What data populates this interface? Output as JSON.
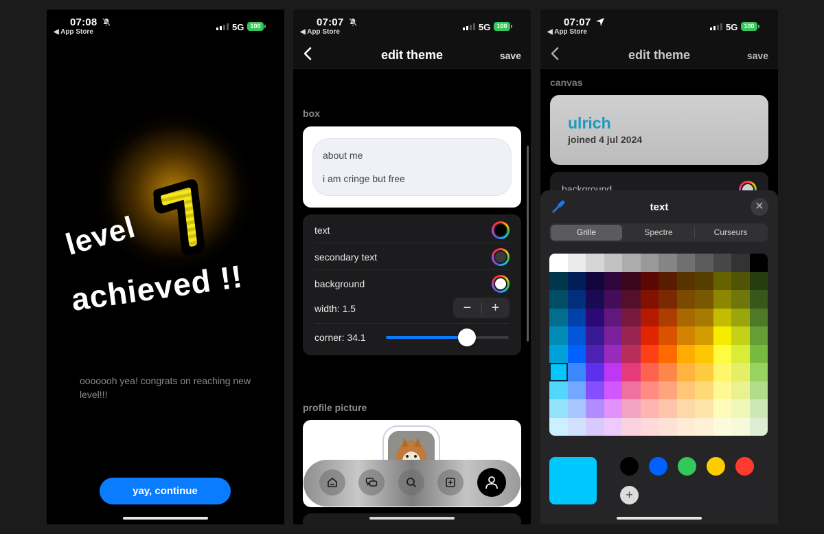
{
  "status_bars": [
    {
      "time": "07:08",
      "indicator_icon": "bell-slash-icon",
      "back_app": "◀ App Store",
      "network": "5G",
      "battery": "100"
    },
    {
      "time": "07:07",
      "indicator_icon": "bell-slash-icon",
      "back_app": "◀ App Store",
      "network": "5G",
      "battery": "100"
    },
    {
      "time": "07:07",
      "indicator_icon": "location-arrow-icon",
      "back_app": "◀ App Store",
      "network": "5G",
      "battery": "100"
    }
  ],
  "level_screen": {
    "level_word": "level",
    "level_number": "1",
    "achieved_word": "achieved !!",
    "message": "ooooooh yea! congrats on reaching new level!!!",
    "continue_label": "yay, continue",
    "colors": {
      "accent": "#0a7cff",
      "glow": "#d7960a",
      "badge_yellow": "#f4e40a"
    }
  },
  "edit_theme": {
    "nav": {
      "back_icon": "chevron-left-icon",
      "title": "edit theme",
      "save_label": "save"
    },
    "box_section": {
      "label": "box",
      "preview": {
        "heading": "about me",
        "body": "i am cringe but free"
      },
      "color_rows": [
        {
          "label": "text",
          "color": "#000000"
        },
        {
          "label": "secondary text",
          "color": "#3a3a3c"
        },
        {
          "label": "background",
          "color": "#ffffff"
        }
      ],
      "width": {
        "label": "width: 1.5",
        "value": 1.5,
        "minus": "−",
        "plus": "+"
      },
      "corner": {
        "label": "corner: 34.1",
        "value": 34.1,
        "slider_fraction": 0.66
      }
    },
    "profile_picture_section": {
      "label": "profile picture"
    },
    "tab_bar": [
      {
        "name": "home",
        "icon": "home-icon",
        "active": false
      },
      {
        "name": "messages",
        "icon": "chat-bubbles-icon",
        "active": false
      },
      {
        "name": "search",
        "icon": "search-icon",
        "active": false
      },
      {
        "name": "create",
        "icon": "plus-square-icon",
        "active": false
      },
      {
        "name": "profile",
        "icon": "person-icon",
        "active": true
      }
    ]
  },
  "edit_theme_picker": {
    "nav": {
      "back_icon": "chevron-left-icon",
      "title": "edit theme",
      "save_label": "save"
    },
    "canvas_section": {
      "label": "canvas",
      "username": "ulrich",
      "joined": "joined 4 jul 2024",
      "username_color": "#1a9ac0",
      "background_row_label": "background"
    },
    "color_picker": {
      "title": "text",
      "eyedropper_icon": "eyedropper-icon",
      "close_label": "✕",
      "tabs": [
        {
          "label": "Grille",
          "selected": true
        },
        {
          "label": "Spectre",
          "selected": false
        },
        {
          "label": "Curseurs",
          "selected": false
        }
      ],
      "selected_color": "#00c8ff",
      "selected_cell": {
        "row": 6,
        "col": 0
      },
      "grid": [
        [
          "#ffffff",
          "#ebebeb",
          "#d6d6d6",
          "#c2c2c2",
          "#adadad",
          "#999999",
          "#858585",
          "#707070",
          "#5c5c5c",
          "#474747",
          "#333333",
          "#000000"
        ],
        [
          "#00374a",
          "#011d57",
          "#11053b",
          "#2e063d",
          "#3c071b",
          "#5c0701",
          "#5a1c00",
          "#583300",
          "#563d00",
          "#666100",
          "#4f5504",
          "#263e0f"
        ],
        [
          "#004d65",
          "#012f7b",
          "#1a0a52",
          "#450d59",
          "#551029",
          "#831100",
          "#7b2900",
          "#7a4a00",
          "#785800",
          "#8c8602",
          "#6f760a",
          "#38571a"
        ],
        [
          "#016e8f",
          "#0042a9",
          "#2c0977",
          "#61187c",
          "#791a3d",
          "#b51a00",
          "#ad3e00",
          "#a96800",
          "#a67b01",
          "#c4bc00",
          "#9ba50e",
          "#4e7a27"
        ],
        [
          "#008cb4",
          "#0056d6",
          "#371a94",
          "#7a219e",
          "#99244f",
          "#e22400",
          "#da5100",
          "#d38301",
          "#d19d01",
          "#f5ec00",
          "#c3d117",
          "#669d34"
        ],
        [
          "#00a1d8",
          "#0061fe",
          "#4d22b2",
          "#982abc",
          "#b92d5d",
          "#ff4015",
          "#ff6a00",
          "#ffab01",
          "#fcc700",
          "#fefb41",
          "#d9ec37",
          "#76bb40"
        ],
        [
          "#01c7fc",
          "#3a87fe",
          "#5e30eb",
          "#be38f3",
          "#e63b7a",
          "#fe6250",
          "#fe8648",
          "#feb43f",
          "#fecb3e",
          "#fff76b",
          "#e4ef65",
          "#96d35f"
        ],
        [
          "#52d6fc",
          "#74a7ff",
          "#864ffe",
          "#d357fe",
          "#ee719e",
          "#ff8c82",
          "#fea57d",
          "#ffc777",
          "#fed977",
          "#fff994",
          "#eaf28f",
          "#b1dd8b"
        ],
        [
          "#93e3fc",
          "#a7c6ff",
          "#b18cfe",
          "#e292fe",
          "#f4a4c0",
          "#ffb5af",
          "#ffc5ab",
          "#fed9a8",
          "#fde4a8",
          "#fffbb9",
          "#f1f7b7",
          "#cde8b5"
        ],
        [
          "#cbf0ff",
          "#d2e2fe",
          "#d8c9fe",
          "#efcaff",
          "#f9d3e0",
          "#ffdad8",
          "#ffe2d6",
          "#feecd4",
          "#fef1d5",
          "#fdfbdd",
          "#f6fadb",
          "#deeed4"
        ]
      ],
      "favorites": [
        "#000000",
        "#0061fe",
        "#34c759",
        "#ffcc00",
        "#ff3b30"
      ],
      "add_favorite_label": "+"
    }
  }
}
